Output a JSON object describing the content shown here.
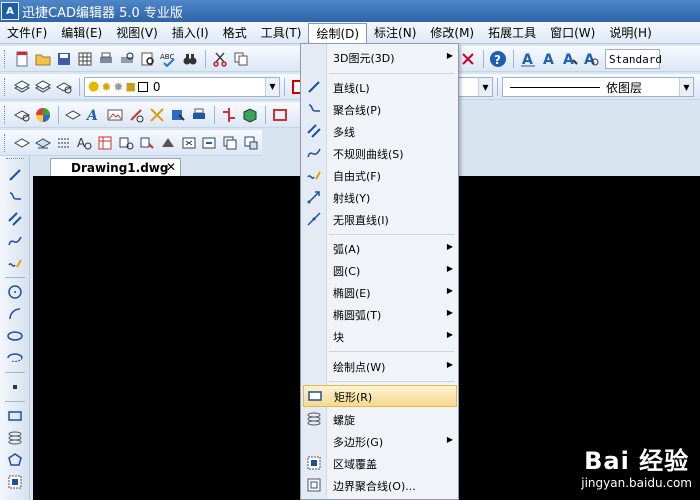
{
  "app": {
    "logo_text": "A",
    "title": "迅捷CAD编辑器 5.0 专业版"
  },
  "menus": [
    "文件(F)",
    "编辑(E)",
    "视图(V)",
    "插入(I)",
    "格式",
    "工具(T)",
    "绘制(D)",
    "标注(N)",
    "修改(M)",
    "拓展工具",
    "窗口(W)",
    "说明(H)"
  ],
  "toolbar": {
    "layer_value": "0",
    "style_value": "Standard",
    "linetype_value": "依图层"
  },
  "document": {
    "tab_label": "Drawing1.dwg",
    "close_glyph": "✕"
  },
  "draw_menu": {
    "items": [
      {
        "label": "3D图元(3D)",
        "submenu": true
      },
      {
        "label": "直线(L)"
      },
      {
        "label": "聚合线(P)"
      },
      {
        "label": "多线"
      },
      {
        "label": "不规则曲线(S)"
      },
      {
        "label": "自由式(F)"
      },
      {
        "label": "射线(Y)"
      },
      {
        "label": "无限直线(I)"
      },
      {
        "label": "弧(A)",
        "submenu": true
      },
      {
        "label": "圆(C)",
        "submenu": true
      },
      {
        "label": "椭圆(E)",
        "submenu": true
      },
      {
        "label": "椭圆弧(T)",
        "submenu": true
      },
      {
        "label": "块",
        "submenu": true
      },
      {
        "label": "绘制点(W)",
        "submenu": true
      },
      {
        "label": "矩形(R)",
        "highlighted": true
      },
      {
        "label": "螺旋"
      },
      {
        "label": "多边形(G)",
        "submenu": true
      },
      {
        "label": "区域覆盖"
      },
      {
        "label": "边界聚合线(O)..."
      }
    ],
    "submenu_glyph": "▶"
  },
  "watermark": {
    "logo": "Bai 经验",
    "url": "jingyan.baidu.com"
  },
  "colors": {
    "title_bar": "#2e63a8",
    "canvas": "#000000",
    "highlight": "#f8d98e"
  }
}
